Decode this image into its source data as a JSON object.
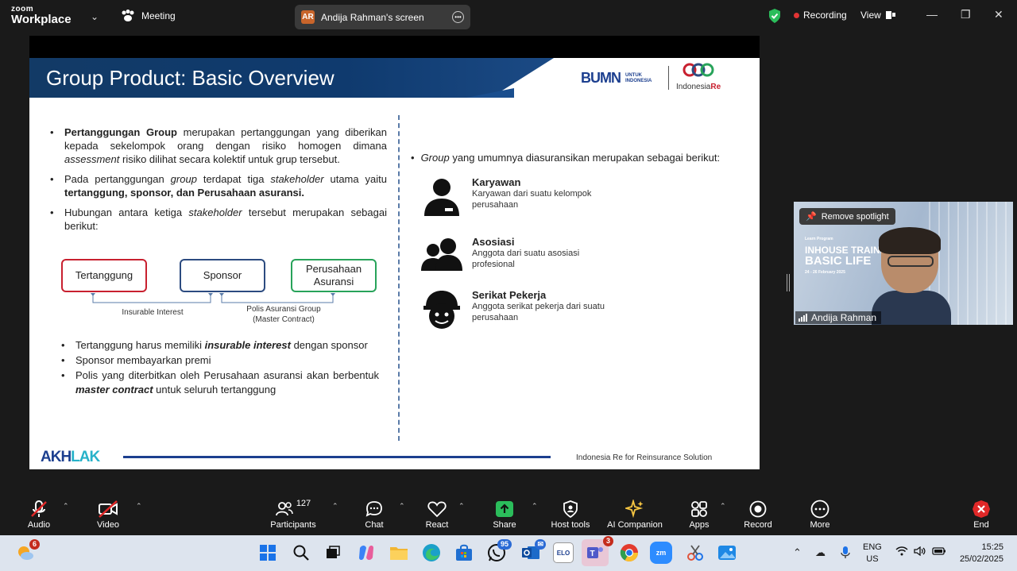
{
  "topbar": {
    "logo_top": "zoom",
    "logo_bottom": "Workplace",
    "meeting_label": "Meeting",
    "screen_initials": "AR",
    "screen_label": "Andija Rahman's screen",
    "recording_label": "Recording",
    "view_label": "View"
  },
  "slide": {
    "title": "Group Product: Basic Overview",
    "bumn_logo": "BUMN",
    "bumn_sub": "UNTUK INDONESIA",
    "indore_name": "Indonesia",
    "indore_re": "Re",
    "left": {
      "b1_bold": "Pertanggungan Group",
      "b1_text1": " merupakan pertanggungan yang diberikan kepada sekelompok orang dengan risiko homogen dimana ",
      "b1_italic": "assessment",
      "b1_text2": " risiko dilihat secara kolektif untuk grup tersebut.",
      "b2_text1": "Pada pertanggungan ",
      "b2_italic1": "group",
      "b2_text2": " terdapat tiga ",
      "b2_italic2": "stakeholder",
      "b2_text3": " utama yaitu ",
      "b2_bold": "tertanggung, sponsor, dan Perusahaan asuransi.",
      "b3_text1": "Hubungan antara ketiga ",
      "b3_italic": "stakeholder",
      "b3_text2": " tersebut merupakan sebagai berikut:"
    },
    "diagram": {
      "box1": "Tertanggung",
      "box2": "Sponsor",
      "box3_line1": "Perusahaan",
      "box3_line2": "Asuransi",
      "label1": "Insurable Interest",
      "label2_line1": "Polis Asuransi Group",
      "label2_line2": "(Master Contract)"
    },
    "left2": {
      "c1_text": "Tertanggung harus memiliki ",
      "c1_bi": "insurable interest",
      "c1_text2": " dengan sponsor",
      "c2": "Sponsor membayarkan premi",
      "c3_text": "Polis yang diterbitkan oleh Perusahaan asuransi akan berbentuk ",
      "c3_bi": "master contract",
      "c3_text2": " untuk seluruh tertanggung"
    },
    "right": {
      "intro_italic": "Group",
      "intro_text": " yang umumnya diasuransikan merupakan sebagai berikut:",
      "cats": [
        {
          "title": "Karyawan",
          "desc": "Karyawan dari suatu kelompok perusahaan",
          "icon": "person-icon"
        },
        {
          "title": "Asosiasi",
          "desc": "Anggota dari suatu asosiasi profesional",
          "icon": "group-icon"
        },
        {
          "title": "Serikat Pekerja",
          "desc": "Anggota serikat pekerja dari suatu perusahaan",
          "icon": "worker-icon"
        }
      ]
    },
    "footer_logo_a": "AKH",
    "footer_logo_b": "LAK",
    "footer_text": "Indonesia Re for Reinsurance Solution"
  },
  "video": {
    "spotlight_label": "Remove spotlight",
    "banner_small": "Learn Program",
    "banner_1": "INHOUSE TRAININ",
    "banner_2": "BASIC LIFE",
    "banner_3": "24 - 26 February 2025",
    "name": "Andija Rahman"
  },
  "toolbar": {
    "items": [
      {
        "label": "Audio"
      },
      {
        "label": "Video"
      },
      {
        "label": "Participants",
        "count": "127"
      },
      {
        "label": "Chat"
      },
      {
        "label": "React"
      },
      {
        "label": "Share"
      },
      {
        "label": "Host tools"
      },
      {
        "label": "AI Companion"
      },
      {
        "label": "Apps"
      },
      {
        "label": "Record"
      },
      {
        "label": "More"
      },
      {
        "label": "End"
      }
    ]
  },
  "taskbar": {
    "weather_badge": "6",
    "whatsapp_badge": "95",
    "teams_badge": "3",
    "lang_line1": "ENG",
    "lang_line2": "US",
    "time": "15:25",
    "date": "25/02/2025"
  },
  "colors": {
    "title_band": "#123a66",
    "box_red": "#c8202f",
    "box_blue": "#2c4b80",
    "box_green": "#28a35a",
    "share_green": "#2bbd5b",
    "end_red": "#e02828"
  }
}
